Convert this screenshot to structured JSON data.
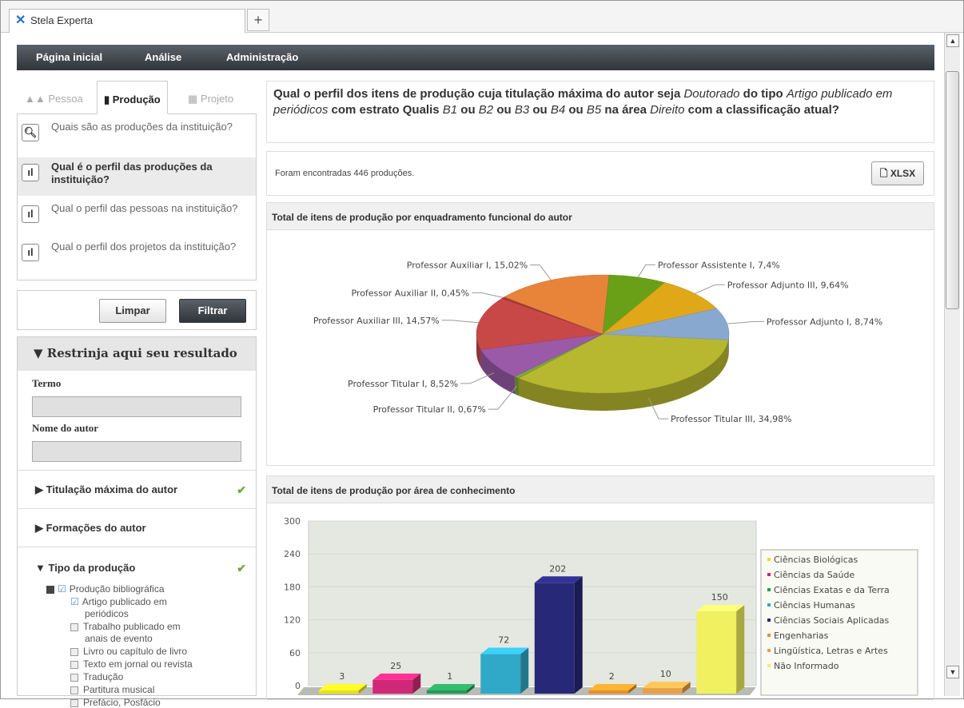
{
  "browser": {
    "tab_title": "Stela Experta",
    "new_tab": "+"
  },
  "nav": {
    "items": [
      "Página inicial",
      "Análise",
      "Administração"
    ]
  },
  "sidebar": {
    "tabs": [
      "Pessoa",
      "Produção",
      "Projeto"
    ],
    "questions": [
      "Quais são as produções da instituição?",
      "Qual é o perfil das produções da instituição?",
      "Qual o perfil das pessoas na instituição?",
      "Qual o perfil dos projetos da instituição?"
    ],
    "clear_label": "Limpar",
    "filter_label": "Filtrar",
    "restrict_title": "Restrinja aqui seu resultado",
    "term_label": "Termo",
    "author_label": "Nome do autor",
    "sections": [
      "Titulação máxima do autor",
      "Formações do autor",
      "Tipo da produção"
    ],
    "tree": [
      "Produção bibliográfica",
      "Artigo publicado em",
      "periódicos",
      "Trabalho publicado em",
      "anais de evento",
      "Livro ou capítulo de livro",
      "Texto em jornal ou revista",
      "Tradução",
      "Partitura musical",
      "Prefácio, Posfácio"
    ]
  },
  "main": {
    "question_parts": {
      "p1": "Qual o perfil dos itens de produção cuja titulação máxima do autor seja ",
      "doutorado": "Doutorado",
      "p2": " do tipo ",
      "artigo": "Artigo publicado em periódicos",
      "p3": " com estrato Qualis ",
      "b1": "B1",
      "ou1": " ou ",
      "b2": "B2",
      "ou2": " ou ",
      "b3": "B3",
      "ou3": " ou ",
      "b4": "B4",
      "ou4": " ou ",
      "b5": "B5",
      "p4": " na área ",
      "direito": "Direito",
      "p5": " com a classificação atual?"
    },
    "result_text": "Foram encontradas 446 produções.",
    "xlsx_label": "XLSX",
    "pie_title": "Total de itens de produção por enquadramento funcional do autor",
    "bar_title": "Total de itens de produção por área de conhecimento"
  },
  "chart_data": [
    {
      "type": "pie",
      "title": "Total de itens de produção por enquadramento funcional do autor",
      "labels": [
        "Professor Titular III, 34,98%",
        "Professor Titular II, 0,67%",
        "Professor Titular I, 8,52%",
        "Professor Auxiliar III, 14,57%",
        "Professor Auxiliar II, 0,45%",
        "Professor Auxiliar I, 15,02%",
        "Professor Assistente I, 7,4%",
        "Professor Adjunto III, 9,64%",
        "Professor Adjunto I, 8,74%"
      ],
      "values": [
        34.98,
        0.67,
        8.52,
        14.57,
        0.45,
        15.02,
        7.4,
        9.64,
        8.74
      ],
      "colors": [
        "#b8b830",
        "#7aa83a",
        "#9a5aa8",
        "#c84848",
        "#a83838",
        "#e8843a",
        "#6aa018",
        "#e0a818",
        "#88a8d0"
      ]
    },
    {
      "type": "bar",
      "title": "Total de itens de produção por área de conhecimento",
      "categories": [
        "Ciências Biológicas",
        "Ciências da Saúde",
        "Ciências Exatas e da Terra",
        "Ciências Humanas",
        "Ciências Sociais Aplicadas",
        "Engenharias",
        "Lingüística, Letras e Artes",
        "Não Informado"
      ],
      "values": [
        3,
        25,
        1,
        72,
        202,
        2,
        10,
        150
      ],
      "colors": [
        "#e8e020",
        "#d02878",
        "#289858",
        "#30a8c8",
        "#282878",
        "#e89028",
        "#e8a048",
        "#f0f060"
      ],
      "yticks": [
        "0",
        "60",
        "120",
        "180",
        "240",
        "300"
      ],
      "ylim": [
        0,
        300
      ],
      "legend": "right"
    }
  ]
}
